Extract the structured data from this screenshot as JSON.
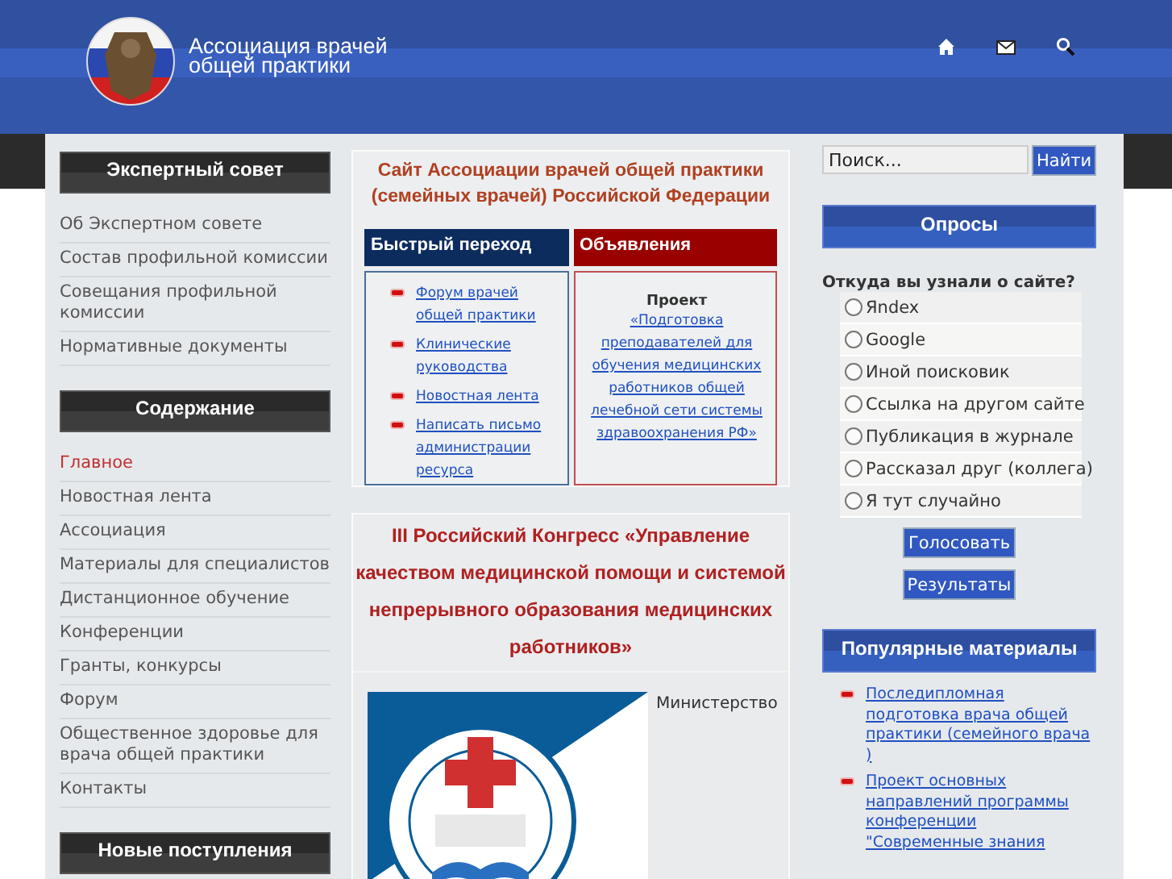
{
  "header": {
    "title_line1": "Ассоциация врачей",
    "title_line2": "общей практики",
    "icons": [
      {
        "kind": "home"
      },
      {
        "kind": "mail"
      },
      {
        "kind": "search"
      }
    ]
  },
  "left": {
    "sections": [
      {
        "title": "Экспертный совет",
        "items": [
          {
            "label": "Об Экспертном совете",
            "selected": false
          },
          {
            "label": "Состав профильной комиссии",
            "selected": false
          },
          {
            "label": "Совещания профильной комиссии",
            "selected": false
          },
          {
            "label": "Нормативные документы",
            "selected": false
          }
        ]
      },
      {
        "title": "Содержание",
        "items": [
          {
            "label": "Главное",
            "selected": true
          },
          {
            "label": "Новостная лента",
            "selected": false
          },
          {
            "label": "Ассоциация",
            "selected": false
          },
          {
            "label": "Материалы для специалистов",
            "selected": false
          },
          {
            "label": "Дистанционное обучение",
            "selected": false
          },
          {
            "label": "Конференции",
            "selected": false
          },
          {
            "label": "Гранты, конкурсы",
            "selected": false
          },
          {
            "label": "Форум",
            "selected": false
          },
          {
            "label": "Общественное здоровье для врача общей практики",
            "selected": false
          },
          {
            "label": "Контакты",
            "selected": false
          }
        ]
      },
      {
        "title": "Новые поступления"
      }
    ]
  },
  "center": {
    "site_title": "Сайт Ассоциации врачей общей практики (семейных врачей) Российской Федерации",
    "quick_nav": {
      "title": "Быстрый переход",
      "links": [
        "Форум врачей общей практики",
        "Клинические руководства",
        "Новостная лента",
        "Написать письмо администрации ресурса"
      ]
    },
    "announcements": {
      "title": "Объявления",
      "label": "Проект",
      "link": "«Подготовка преподавателей для обучения медицинских работников общей лечебной сети системы здравоохранения РФ»"
    },
    "congress": {
      "title": "III Российский Конгресс «Управление качеством медицинской помощи и системой непрерывного образования медицинских работников»",
      "text": "Министерство"
    }
  },
  "right": {
    "search": {
      "placeholder": "Поиск...",
      "button": "Найти"
    },
    "poll": {
      "title": "Опросы",
      "question": "Откуда вы узнали о сайте?",
      "options": [
        {
          "label": "Яndex",
          "selected": false
        },
        {
          "label": "Google",
          "selected": false
        },
        {
          "label": "Иной поисковик",
          "selected": false
        },
        {
          "label": "Ссылка на другом сайте",
          "selected": false
        },
        {
          "label": "Публикация в журнале",
          "selected": false
        },
        {
          "label": "Рассказал друг (коллега)",
          "selected": false
        },
        {
          "label": "Я тут случайно",
          "selected": false
        }
      ],
      "buttons": [
        "Голосовать",
        "Результаты"
      ]
    },
    "popular": {
      "title": "Популярные материалы",
      "links": [
        "Последипломная подготовка врача общей практики (семейного врача )",
        "Проект основных направлений программы конференции \"Современные знания"
      ]
    }
  }
}
